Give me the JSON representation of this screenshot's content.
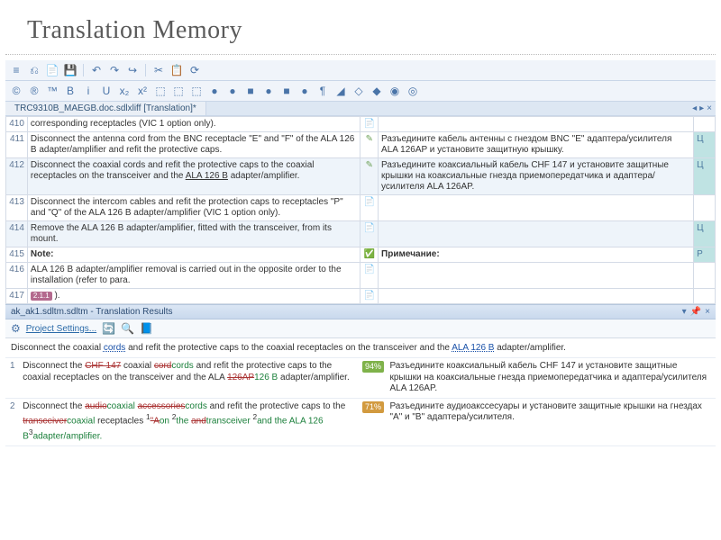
{
  "slide": {
    "title": "Translation Memory"
  },
  "toolbar1_icons": [
    "≡",
    "⎌",
    "📄",
    "💾",
    "↶",
    "↷",
    "↪",
    "✂",
    "📋",
    "⟳"
  ],
  "toolbar2_icons": [
    "©",
    "®",
    "™",
    "B",
    "i",
    "U",
    "x₂",
    "x²",
    "⬚",
    "⬚",
    "⬚",
    "●",
    "●",
    "■",
    "●",
    "■",
    "●",
    "¶",
    "◢",
    "◇",
    "◆",
    "◉",
    "◎"
  ],
  "doc_tab": "TRC9310B_MAEGB.doc.sdlxliff [Translation]*",
  "segments": [
    {
      "num": "410",
      "src_html": "corresponding receptacles (VIC 1 option only).",
      "status": "doc-ok",
      "tgt": "",
      "flag": ""
    },
    {
      "num": "411",
      "src_html": "Disconnect the antenna cord from the BNC receptacle \"E\" and \"F\" of the ALA 126 B adapter/amplifier and refit the protective caps.",
      "status": "edited",
      "tgt": "Разъедините кабель антенны с гнездом BNC \"E\" адаптера/усилителя ALA 126AP и установите защитную крышку.",
      "flag": "Ц"
    },
    {
      "num": "412",
      "src_html": "Disconnect the coaxial cords and refit the protective caps to the coaxial receptacles on the transceiver and the <u>ALA 126 B</u> adapter/amplifier.",
      "status": "edited",
      "tgt": "Разъедините коаксиальный кабель CHF 147 и установите защитные крышки на коаксиальные гнезда приемопередатчика и адаптера/усилителя ALA 126AP.",
      "flag": "Ц",
      "alt": true
    },
    {
      "num": "413",
      "src_html": "Disconnect the intercom cables and refit the protection caps to receptacles \"P\" and \"Q\" of the ALA 126 B adapter/amplifier (VIC 1 option only).",
      "status": "doc-ok",
      "tgt": "",
      "flag": ""
    },
    {
      "num": "414",
      "src_html": "Remove the ALA 126 B adapter/amplifier, fitted with the transceiver, from its mount.",
      "status": "doc-ok",
      "tgt": "",
      "flag": "Ц",
      "alt": true
    },
    {
      "num": "415",
      "src_html": "<b>Note:</b>",
      "status": "confirmed",
      "tgt_html": "<b>Примечание:</b>",
      "flag": "P"
    },
    {
      "num": "416",
      "src_html": "ALA 126 B adapter/amplifier removal is carried out in the opposite order to the installation (refer to para.",
      "status": "doc-ok",
      "tgt": "",
      "flag": ""
    },
    {
      "num": "417",
      "src_html": "<span class=\"tag-chip\">2.1.1</span> ).",
      "status": "doc-ok",
      "tgt": "",
      "flag": ""
    }
  ],
  "tm_panel_title": "ak_ak1.sdltm.sdltm - Translation Results",
  "project_settings_label": "Project Settings...",
  "tm_lookup_sentence_html": "Disconnect the coaxial <span class=\"ul\">cords</span> and refit the protective caps to the coaxial receptacles on the transceiver and the <span class=\"ul\">ALA 126 B</span> adapter/amplifier.",
  "tm_matches": [
    {
      "num": "1",
      "score": "94%",
      "score_class": "score-94",
      "src_html": "Disconnect the <span class=\"strike-red\">CHF 147</span> coaxial <span class=\"strike-red\">cord</span><span class=\"ins-green\">cords</span> and refit the protective caps to the coaxial receptacles on the transceiver and the ALA <span class=\"strike-red\">126AP</span><span class=\"ins-green\">126 B</span> adapter/amplifier.",
      "tgt": "Разъедините коаксиальный кабель CHF 147 и установите защитные крышки на коаксиальные гнезда приемопередатчика и адаптера/усилителя ALA 126AP."
    },
    {
      "num": "2",
      "score": "71%",
      "score_class": "score-71",
      "src_html": "Disconnect the <span class=\"strike-red\">audio</span><span class=\"ins-green\">coaxial</span> <span class=\"strike-red\">accessories</span><span class=\"ins-green\">cords</span> and refit the protective caps to the <span class=\"strike-red\">transceiver</span><span class=\"ins-green\">coaxial</span> receptacles <sup>1</sup><span class=\"strike-red\">\"A</span><span class=\"ins-green\">on </span><sup>2</sup><span class=\"ins-green\">the </span><span class=\"strike-red\">and</span><span class=\"ins-green\">transceiver </span><sup>2</sup><span class=\"ins-green\">and the ALA 126 B</span><sup>3</sup><span class=\"ins-green\">adapter/amplifier.</span>",
      "tgt": "Разъедините аудиоакссесуары и установите защитные крышки на гнездах \"A\" и \"B\" адаптера/усилителя."
    }
  ]
}
